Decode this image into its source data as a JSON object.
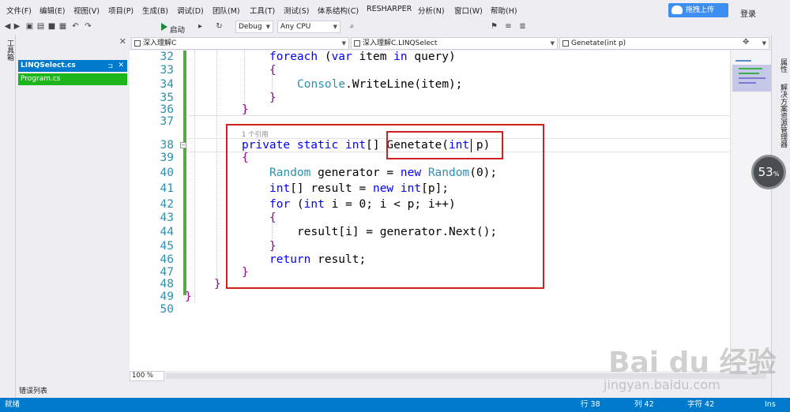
{
  "menu": {
    "items": [
      "文件(F)",
      "编辑(E)",
      "视图(V)",
      "项目(P)",
      "生成(B)",
      "调试(D)",
      "团队(M)",
      "工具(T)",
      "测试(S)",
      "体系结构(C)",
      "RESHARPER",
      "分析(N)",
      "窗口(W)",
      "帮助(H)"
    ],
    "upload_label": "拖拽上传",
    "login_label": "登录"
  },
  "toolbar": {
    "start_label": "启动",
    "config_value": "Debug",
    "platform_value": "Any CPU"
  },
  "left_strip": {
    "label": "工具箱"
  },
  "solution": {
    "files": [
      "LINQSelect.cs",
      "Program.cs"
    ],
    "bottom_tab": "错误列表"
  },
  "nav": {
    "project": "深入理解C",
    "class": "深入理解C.LINQSelect",
    "member": "Genetate(int p)"
  },
  "editor": {
    "ref_hint": "1 个引用",
    "lines": [
      {
        "n": "32",
        "text": ""
      },
      {
        "n": "33",
        "text": ""
      },
      {
        "n": "34",
        "text": ""
      },
      {
        "n": "35",
        "text": ""
      },
      {
        "n": "36",
        "text": ""
      },
      {
        "n": "37",
        "text": ""
      },
      {
        "n": "38",
        "text": ""
      },
      {
        "n": "39",
        "text": ""
      },
      {
        "n": "40",
        "text": ""
      },
      {
        "n": "41",
        "text": ""
      },
      {
        "n": "42",
        "text": ""
      },
      {
        "n": "43",
        "text": ""
      },
      {
        "n": "44",
        "text": ""
      },
      {
        "n": "45",
        "text": ""
      },
      {
        "n": "46",
        "text": ""
      },
      {
        "n": "47",
        "text": ""
      },
      {
        "n": "48",
        "text": ""
      },
      {
        "n": "49",
        "text": ""
      },
      {
        "n": "50",
        "text": ""
      }
    ],
    "code": {
      "l32_foreach": "foreach",
      "l32_rest1": " (",
      "l32_var": "var",
      "l32_rest2": " item ",
      "l32_in": "in",
      "l32_rest3": " query)",
      "l34_console": "Console",
      "l34_rest": ".WriteLine(item);",
      "l38_private": "private",
      "l38_static": "static",
      "l38_int": "int",
      "l38_arr": "[]",
      "l38_name": "Genetate(",
      "l38_int2": "int",
      "l38_p": " p)",
      "l40_random": "Random",
      "l40_mid": " generator = ",
      "l40_new": "new",
      "l40_random2": "Random",
      "l40_end": "(0);",
      "l41_int": "int",
      "l41_mid": "[] result = ",
      "l41_new": "new",
      "l41_int2": "int",
      "l41_end": "[p];",
      "l42_for": "for",
      "l42_open": " (",
      "l42_int": "int",
      "l42_end": " i = 0; i < p; i++)",
      "l44_text": "result[i] = generator.Next();",
      "l46_return": "return",
      "l46_end": " result;",
      "brace_open": "{",
      "brace_close": "}"
    },
    "zoom": "100 %"
  },
  "right_strip": {
    "labels": [
      "属性",
      "解决方案资源管理器"
    ]
  },
  "status": {
    "ready": "就绪",
    "row": "行 38",
    "col": "列 42",
    "char": "字符 42",
    "mode": "Ins"
  },
  "overlay": {
    "percent": "53",
    "percent_unit": "%"
  },
  "watermark": {
    "main": "Bai du 经验",
    "sub": "jingyan.baidu.com"
  },
  "colors": {
    "accent": "#007acc",
    "keyword": "#0000ff",
    "type": "#2b91af",
    "box": "#cc2222"
  }
}
